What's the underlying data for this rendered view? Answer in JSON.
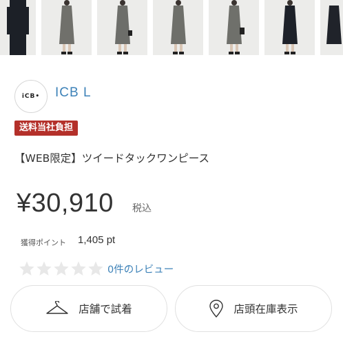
{
  "product_images": [
    {
      "name": "product-thumbnail-1",
      "dress": "#1c2027"
    },
    {
      "name": "product-thumbnail-2",
      "dress": "#70706b"
    },
    {
      "name": "product-thumbnail-3",
      "dress": "#6d6e6a"
    },
    {
      "name": "product-thumbnail-4",
      "dress": "#6e6f6a"
    },
    {
      "name": "product-thumbnail-5",
      "dress": "#6f706b"
    },
    {
      "name": "product-thumbnail-6",
      "dress": "#1d2129"
    },
    {
      "name": "product-thumbnail-7",
      "dress": "#20232a"
    }
  ],
  "brand": {
    "logo_text": "iCB•",
    "name": "ICB L"
  },
  "badge": "送料当社負担",
  "product": {
    "title": "【WEB限定】ツイードタックワンピース",
    "price": "¥30,910",
    "tax": "税込",
    "points_label": "獲得ポイント",
    "points_value": "1,405 pt"
  },
  "reviews": {
    "rating": 0,
    "max": 5,
    "link": "0件のレビュー"
  },
  "buttons": {
    "try_in_store": {
      "label": "店舗で試着",
      "icon": "hanger-icon"
    },
    "store_stock": {
      "label": "店頭在庫表示",
      "icon": "location-pin-icon"
    }
  },
  "colors": {
    "accent": "#3d82b8",
    "badge": "#b4302a",
    "star_empty": "#e8e8e8"
  }
}
